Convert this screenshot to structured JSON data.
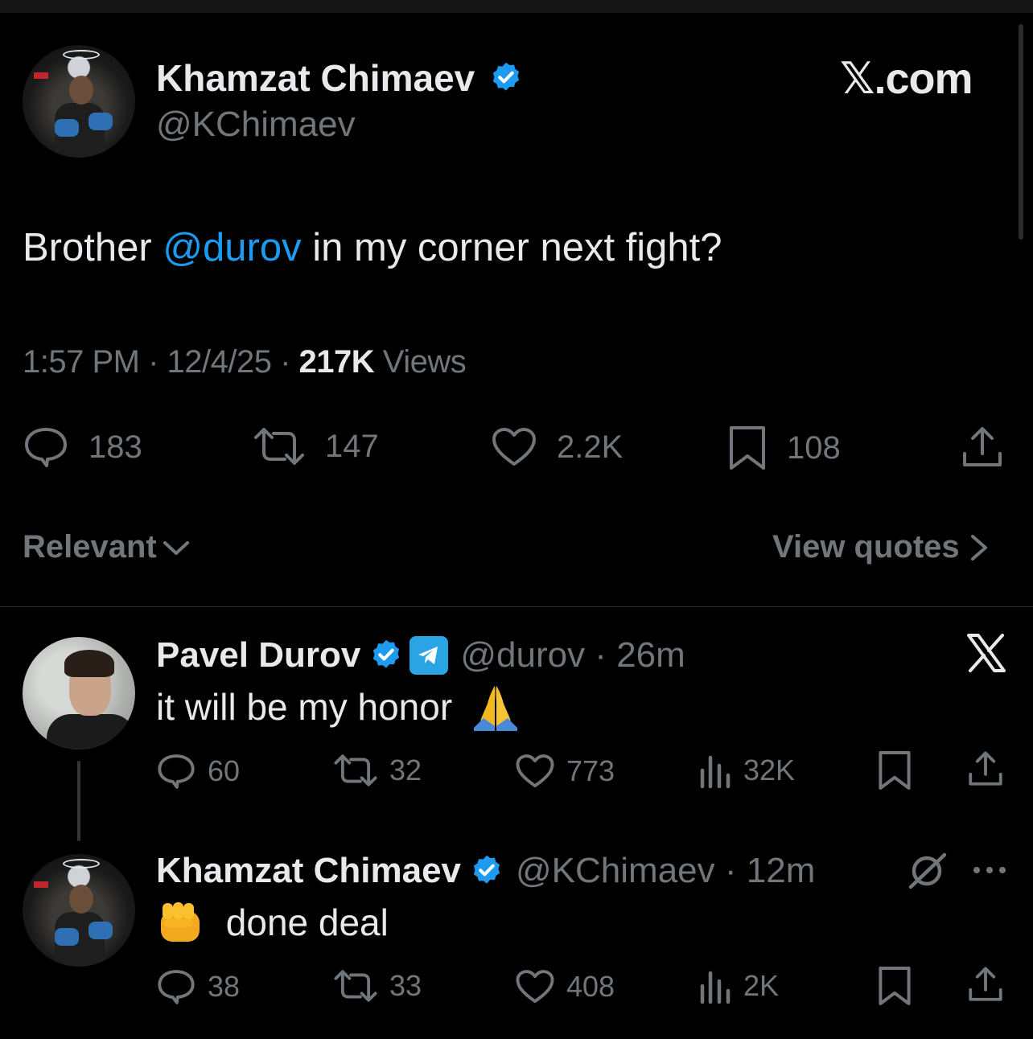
{
  "colors": {
    "background": "#000000",
    "text": "#e7e9ea",
    "muted": "#71767b",
    "link": "#1d9bf0",
    "verified": "#1d9bf0",
    "divider": "#2f3336"
  },
  "brand": "𝕏.com",
  "main_tweet": {
    "author": "Khamzat Chimaev",
    "handle": "@KChimaev",
    "verified": true,
    "text_before": "Brother ",
    "mention": "@durov",
    "text_after": " in my corner next fight?",
    "time": "1:57 PM",
    "date": "12/4/25",
    "sep": " · ",
    "views_count": "217K",
    "views_label": " Views",
    "actions": {
      "replies": "183",
      "reposts": "147",
      "likes": "2.2K",
      "bookmarks": "108",
      "icons": [
        "reply-icon",
        "repost-icon",
        "like-icon",
        "bookmark-icon",
        "share-icon"
      ]
    }
  },
  "sort": {
    "label": "Relevant",
    "view_quotes": "View quotes"
  },
  "replies": [
    {
      "author": "Pavel Durov",
      "handle": "@durov",
      "age": "26m",
      "sep": " · ",
      "text": "it will be my honor",
      "emoji": "folded-hands",
      "affiliate_icon": "telegram-icon",
      "right_icon": "x-logo-icon",
      "actions": {
        "replies": "60",
        "reposts": "32",
        "likes": "773",
        "views": "32K"
      }
    },
    {
      "author": "Khamzat Chimaev",
      "handle": "@KChimaev",
      "age": "12m",
      "sep": " · ",
      "text": "done deal",
      "emoji": "oncoming-fist",
      "right_icon": "grok-icon",
      "more_icon": "more-icon",
      "actions": {
        "replies": "38",
        "reposts": "33",
        "likes": "408",
        "views": "2K"
      }
    }
  ]
}
